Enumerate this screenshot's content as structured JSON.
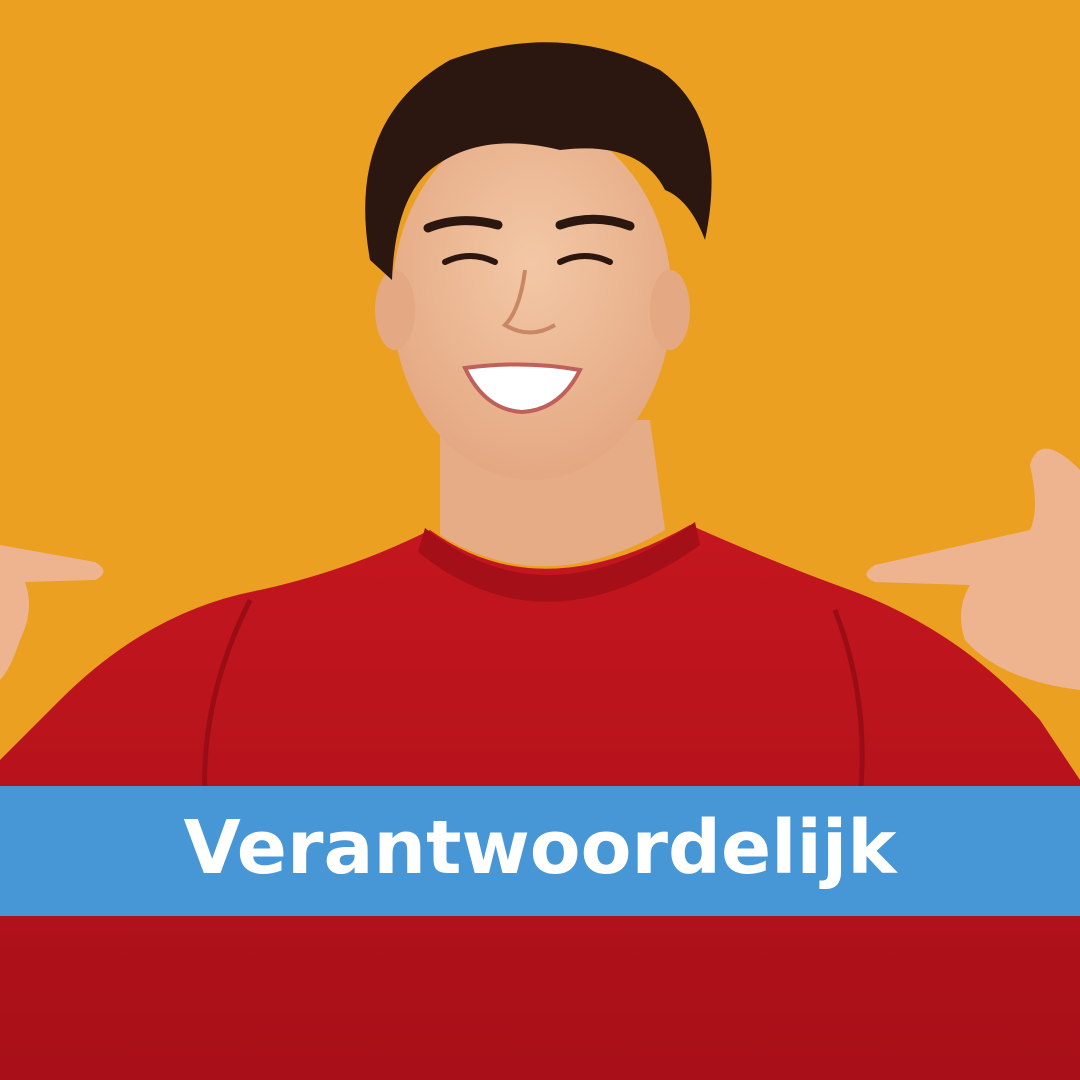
{
  "banner": {
    "label": "Verantwoordelijk",
    "color": "#4797D7",
    "text_color": "#FFFFFF"
  },
  "background": {
    "color": "#EBA021"
  },
  "sweater": {
    "color": "#B5121B"
  }
}
